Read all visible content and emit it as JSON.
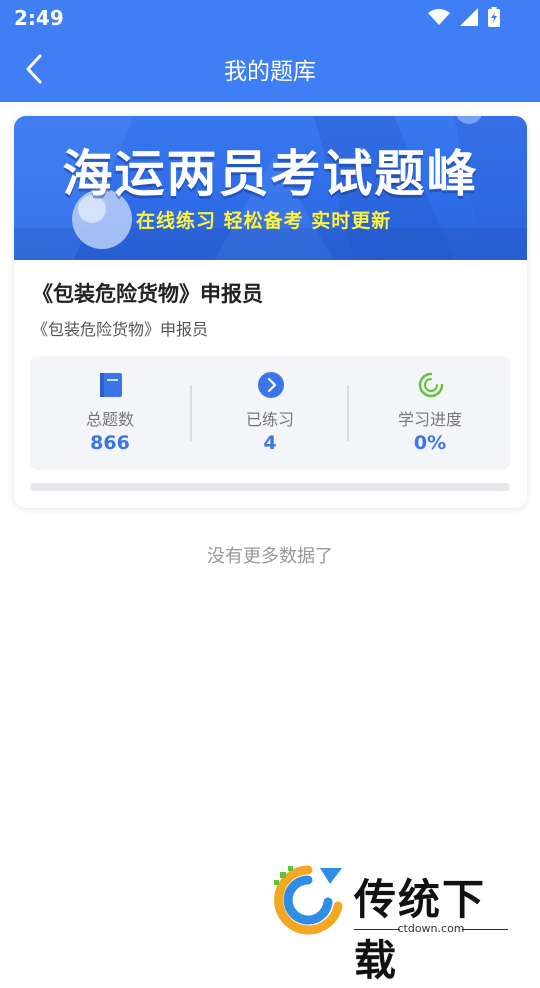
{
  "status_bar": {
    "time": "2:49"
  },
  "app_bar": {
    "title": "我的题库"
  },
  "card": {
    "banner_title": "海运两员考试题峰",
    "banner_subtitle": "在线练习 轻松备考 实时更新",
    "title": "《包装危险货物》申报员",
    "subtitle": "《包装危险货物》申报员",
    "stats": [
      {
        "icon": "book-icon",
        "label": "总题数",
        "value": "866"
      },
      {
        "icon": "arrow-circle-icon",
        "label": "已练习",
        "value": "4"
      },
      {
        "icon": "progress-ring-icon",
        "label": "学习进度",
        "value": "0%"
      }
    ],
    "progress_fraction": 0.0
  },
  "footer_text": "没有更多数据了",
  "watermark": {
    "name": "传统下载",
    "url": "ctdown.com"
  },
  "colors": {
    "primary": "#3f7ef5",
    "accent_value": "#3a76e8",
    "banner_subtitle": "#fff23a"
  }
}
